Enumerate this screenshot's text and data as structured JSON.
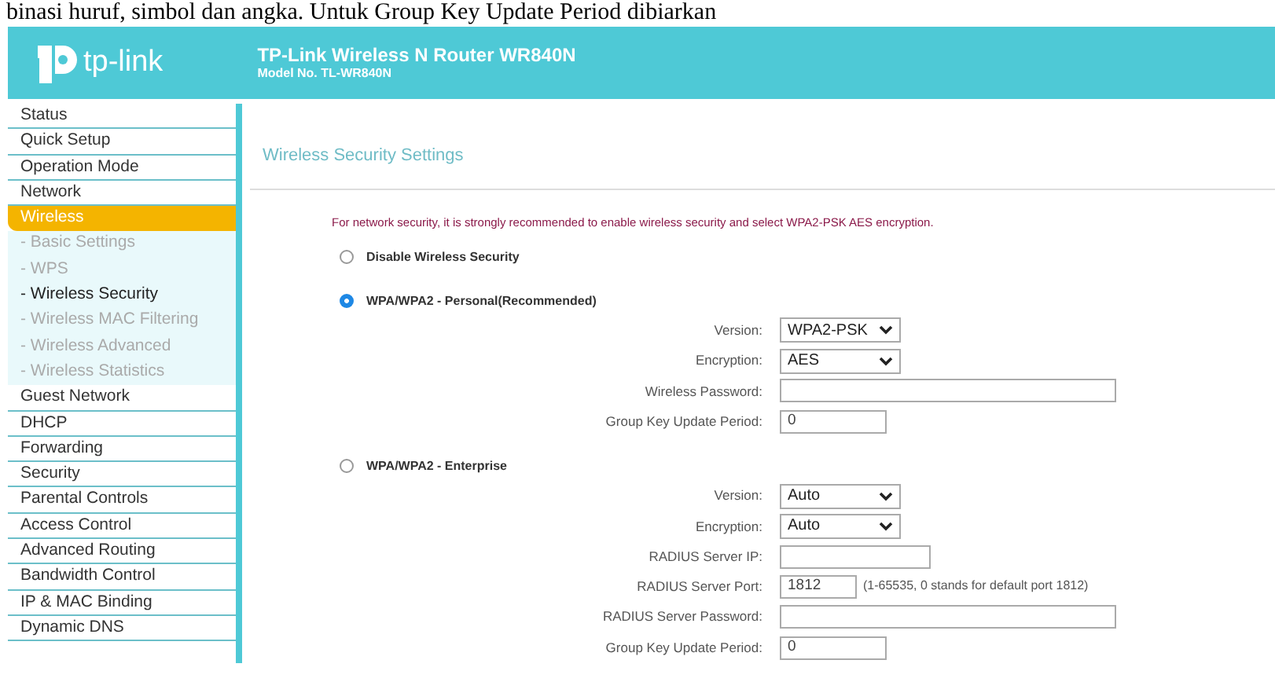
{
  "document_text": "binasi huruf, simbol dan angka. Untuk Group Key Update Period dibiarkan",
  "header": {
    "logo_text": "tp-link",
    "title": "TP-Link Wireless N Router WR840N",
    "model": "Model No. TL-WR840N"
  },
  "sidebar": {
    "items": [
      {
        "label": "Status",
        "selected": false
      },
      {
        "label": "Quick Setup",
        "selected": false
      },
      {
        "label": "Operation Mode",
        "selected": false
      },
      {
        "label": "Network",
        "selected": false
      },
      {
        "label": "Wireless",
        "selected": true,
        "children": [
          {
            "label": "- Basic Settings",
            "selected": false
          },
          {
            "label": "- WPS",
            "selected": false
          },
          {
            "label": "- Wireless Security",
            "selected": true
          },
          {
            "label": "- Wireless MAC Filtering",
            "selected": false
          },
          {
            "label": "- Wireless Advanced",
            "selected": false
          },
          {
            "label": "- Wireless Statistics",
            "selected": false
          }
        ]
      },
      {
        "label": "Guest Network",
        "selected": false
      },
      {
        "label": "DHCP",
        "selected": false
      },
      {
        "label": "Forwarding",
        "selected": false
      },
      {
        "label": "Security",
        "selected": false
      },
      {
        "label": "Parental Controls",
        "selected": false
      },
      {
        "label": "Access Control",
        "selected": false
      },
      {
        "label": "Advanced Routing",
        "selected": false
      },
      {
        "label": "Bandwidth Control",
        "selected": false
      },
      {
        "label": "IP & MAC Binding",
        "selected": false
      },
      {
        "label": "Dynamic DNS",
        "selected": false
      }
    ]
  },
  "content": {
    "title": "Wireless Security Settings",
    "notice": "For network security, it is strongly recommended to enable wireless security and select WPA2-PSK AES encryption.",
    "options": [
      {
        "label": "Disable Wireless Security",
        "selected": false
      },
      {
        "label": "WPA/WPA2 - Personal(Recommended)",
        "selected": true,
        "fields": [
          {
            "label": "Version:",
            "kind": "select",
            "value": "WPA2-PSK"
          },
          {
            "label": "Encryption:",
            "kind": "select",
            "value": "AES"
          },
          {
            "label": "Wireless Password:",
            "kind": "long"
          },
          {
            "label": "Group Key Update Period:",
            "kind": "short",
            "value": "0"
          }
        ]
      },
      {
        "label": "WPA/WPA2 - Enterprise",
        "selected": false,
        "fields": [
          {
            "label": "Version:",
            "kind": "select",
            "value": "Auto"
          },
          {
            "label": "Encryption:",
            "kind": "select",
            "value": "Auto"
          },
          {
            "label": "RADIUS Server IP:",
            "kind": "medium"
          },
          {
            "label": "RADIUS Server Port:",
            "kind": "tiny",
            "value": "1812",
            "note": "(1-65535, 0 stands for default port 1812)"
          },
          {
            "label": "RADIUS Server Password:",
            "kind": "long"
          },
          {
            "label": "Group Key Update Period:",
            "kind": "short",
            "value": "0"
          }
        ]
      }
    ]
  }
}
